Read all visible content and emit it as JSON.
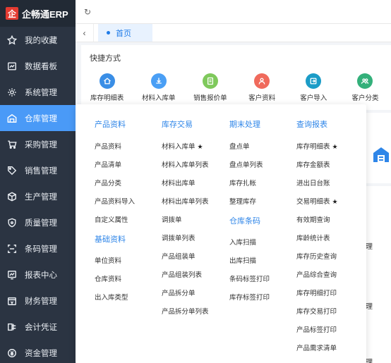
{
  "brand": {
    "logo_char": "企",
    "title": "企畅通ERP"
  },
  "sidebar": {
    "items": [
      {
        "label": "我的收藏",
        "icon": "star-icon"
      },
      {
        "label": "数据看板",
        "icon": "dashboard-icon"
      },
      {
        "label": "系统管理",
        "icon": "gear-icon"
      },
      {
        "label": "仓库管理",
        "icon": "warehouse-icon",
        "active": true
      },
      {
        "label": "采购管理",
        "icon": "cart-icon"
      },
      {
        "label": "销售管理",
        "icon": "tag-icon"
      },
      {
        "label": "生产管理",
        "icon": "box-icon"
      },
      {
        "label": "质量管理",
        "icon": "shield-icon"
      },
      {
        "label": "条码管理",
        "icon": "scan-icon"
      },
      {
        "label": "报表中心",
        "icon": "chart-icon"
      },
      {
        "label": "财务管理",
        "icon": "finance-icon"
      },
      {
        "label": "会计凭证",
        "icon": "voucher-icon"
      },
      {
        "label": "资金管理",
        "icon": "money-icon"
      }
    ]
  },
  "topbar": {
    "refresh_icon": "refresh-icon"
  },
  "tabs": {
    "home_label": "首页"
  },
  "shortcuts": {
    "title": "快捷方式",
    "items": [
      {
        "label": "库存明细表",
        "color": "#3a8ee6"
      },
      {
        "label": "材料入库单",
        "color": "#4a9ff5"
      },
      {
        "label": "销售报价单",
        "color": "#7fc95c"
      },
      {
        "label": "客户资料",
        "color": "#f06a5c"
      },
      {
        "label": "客户导入",
        "color": "#1b9cc7"
      },
      {
        "label": "客户分类",
        "color": "#33b07a"
      }
    ]
  },
  "partial_text": {
    "a": "理",
    "b": "理",
    "c": "理"
  },
  "mega_menu": {
    "col1": {
      "head1": "产品资料",
      "items1": [
        "产品资料",
        "产品清单",
        "产品分类",
        "产品资料导入",
        "自定义属性"
      ],
      "head2": "基础资料",
      "items2": [
        "单位资料",
        "仓库资料",
        "出入库类型"
      ]
    },
    "col2": {
      "head1": "库存交易",
      "items1": [
        "材料入库单",
        "材料入库单列表",
        "材料出库单",
        "材料出库单列表",
        "调拨单",
        "调拨单列表",
        "产品组装单",
        "产品组装列表",
        "产品拆分单",
        "产品拆分单列表"
      ]
    },
    "col3": {
      "head1": "期末处理",
      "items1": [
        "盘点单",
        "盘点单列表",
        "库存扎帐",
        "整理库存"
      ],
      "head2": "仓库条码",
      "items2": [
        "入库扫描",
        "出库扫描",
        "条码标签打印",
        "库存标签打印"
      ]
    },
    "col4": {
      "head1": "查询报表",
      "items1": [
        "库存明细表",
        "库存金额表",
        "进出日台账",
        "交易明细表",
        "有效期查询",
        "库龄统计表",
        "库存历史查询",
        "产品综合查询",
        "库存明细打印",
        "库存交易打印",
        "产品标签打印",
        "产品需求清单"
      ]
    }
  }
}
